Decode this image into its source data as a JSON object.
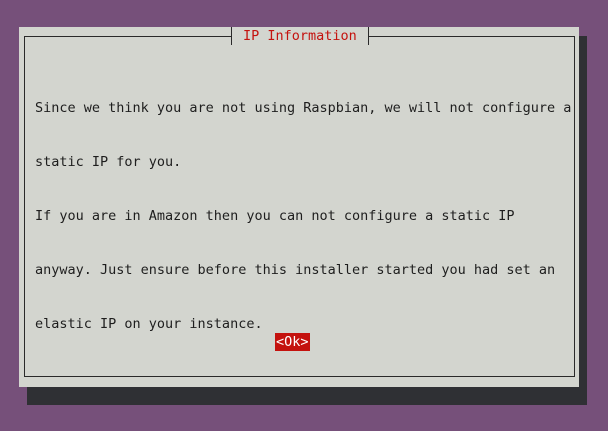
{
  "dialog": {
    "title": "IP Information",
    "message_lines": [
      "Since we think you are not using Raspbian, we will not configure a",
      "static IP for you.",
      "If you are in Amazon then you can not configure a static IP",
      "anyway. Just ensure before this installer started you had set an",
      "elastic IP on your instance."
    ],
    "ok_label": "<Ok>"
  },
  "colors": {
    "background": "#76507a",
    "dialog": "#d3d5cf",
    "accent": "#c4120e",
    "shadow": "#2f3034"
  }
}
